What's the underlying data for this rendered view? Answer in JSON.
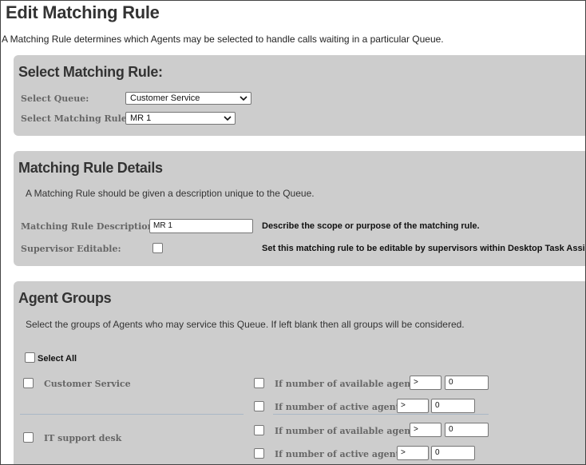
{
  "page": {
    "title": "Edit Matching Rule",
    "intro": "A Matching Rule determines which Agents may be selected to handle calls waiting in a particular Queue."
  },
  "select_section": {
    "title": "Select Matching Rule:",
    "queue_label": "Select Queue:",
    "queue_value": "Customer Service",
    "rule_label": "Select Matching Rule:",
    "rule_value": "MR 1"
  },
  "details_section": {
    "title": "Matching Rule Details",
    "description": "A Matching Rule should be given a description unique to the Queue.",
    "desc_label": "Matching Rule Description:",
    "desc_value": "MR 1",
    "desc_hint": "Describe the scope or purpose of the matching rule.",
    "editable_label": "Supervisor Editable:",
    "editable_checked": false,
    "editable_hint": "Set this matching rule to be editable by supervisors within Desktop Task Assistant."
  },
  "agent_groups": {
    "title": "Agent Groups",
    "description": "Select the groups of Agents who may service this Queue. If left blank then all groups will be considered.",
    "select_all_label": "Select All",
    "groups": [
      {
        "name": "Customer Service",
        "available": {
          "label": "If number of available agents",
          "operator": ">",
          "value": "0"
        },
        "active": {
          "label": "If number of active agents",
          "operator": ">",
          "value": "0"
        }
      },
      {
        "name": "IT support desk",
        "available": {
          "label": "If number of available agents",
          "operator": ">",
          "value": "0"
        },
        "active": {
          "label": "If number of active agents",
          "operator": ">",
          "value": "0"
        }
      }
    ]
  }
}
